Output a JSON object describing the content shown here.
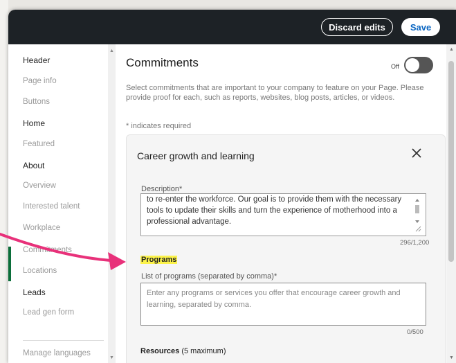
{
  "topbar": {
    "discard_label": "Discard edits",
    "save_label": "Save"
  },
  "sidebar": {
    "groups": [
      {
        "heading": "Header",
        "items": [
          "Page info",
          "Buttons"
        ]
      },
      {
        "heading": "Home",
        "items": [
          "Featured"
        ]
      },
      {
        "heading": "About",
        "items": [
          "Overview",
          "Interested talent",
          "Workplace",
          "Commitments",
          "Locations"
        ]
      },
      {
        "heading": "Leads",
        "items": [
          "Lead gen form"
        ]
      }
    ],
    "footer_item": "Manage languages",
    "active_item": "Commitments"
  },
  "main": {
    "title": "Commitments",
    "toggle_label": "Off",
    "toggle_state": "off",
    "description": "Select commitments that are important to your company to feature on your Page. Please provide proof for each, such as reports, websites, blog posts, articles, or videos.",
    "required_note": "* indicates required",
    "card": {
      "title": "Career growth and learning",
      "description_label": "Description*",
      "description_value": "to re-enter the workforce. Our goal is to provide them with the necessary tools to update their skills and turn the experience of motherhood into a professional advantage.",
      "description_counter": "296/1,200",
      "programs_heading": "Programs",
      "programs_label": "List of programs (separated by comma)*",
      "programs_placeholder": "Enter any programs or services you offer that encourage career growth and learning, separated by comma.",
      "programs_counter": "0/500",
      "resources_label": "Resources",
      "resources_hint": "(5 maximum)"
    }
  },
  "annotation": {
    "arrow_color": "#e8317a",
    "highlight_color": "#fcf34a"
  }
}
